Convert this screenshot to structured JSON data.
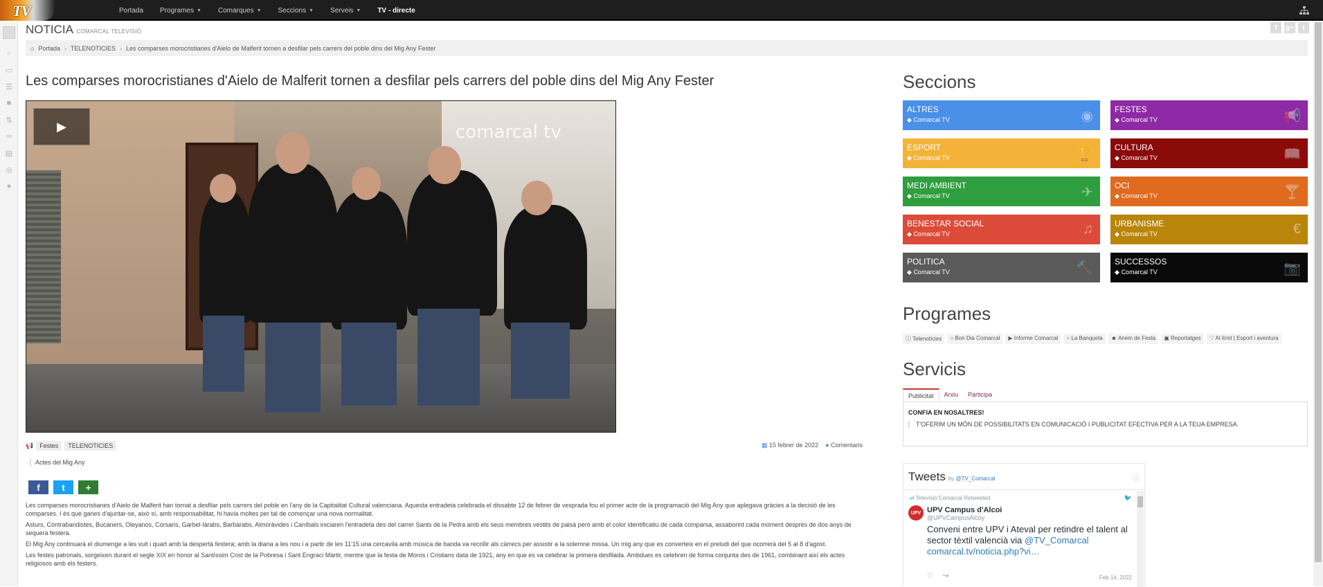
{
  "nav": {
    "logo_text": "TV",
    "items": [
      {
        "label": "Portada",
        "caret": false
      },
      {
        "label": "Programes",
        "caret": true
      },
      {
        "label": "Comarques",
        "caret": true
      },
      {
        "label": "Seccions",
        "caret": true
      },
      {
        "label": "Serveis",
        "caret": true
      },
      {
        "label": "TV - directe",
        "caret": false,
        "bold": true
      }
    ]
  },
  "header": {
    "title": "NOTICIA",
    "subtitle": "COMARCAL TELEVISIÓ"
  },
  "breadcrumb": {
    "home": "Portada",
    "section": "TELENOTICIES",
    "current": "Les comparses morocristianes d'Aielo de Malferit tornen a desfilar pels carrers del poble dins del Mig Any Fester"
  },
  "article": {
    "headline": "Les comparses morocristianes d'Aielo de Malferit tornen a desfilar pels carrers del poble dins del Mig Any Fester",
    "video_watermark": "comarcal tv",
    "tags": [
      "Festes",
      "TELENOTICIES"
    ],
    "date": "15 febrer de 2022",
    "comments": "Comentaris",
    "event": "Actes del Mig Any",
    "paragraphs": [
      "Les comparses morocristianes d'Aielo de Malferit han tornat a desfilar pels carrers del poble en l'any de la Capitalitat Cultural valenciana. Aquesta entradeta celebrada el dissabte 12 de febrer de vesprada fou el primer acte de la programació del Mig Any que aplegava gràcies a la decisió de les comparses. I és que ganes d'ajuntar-se, això sí, amb responsabilitat, hi havia moltes per tal de començar una nova normalitat.",
      "Asturs, Contrabandistes, Bucaners, Oleyanos, Corsaris, Garbel·làrabs, Barbàrabs, Almoràvides i Caníbals iniciaren l'entradeta des del carrer Sants de la Pedra amb els seus membres vestits de paisà però amb el color identificatiu de cada comparsa, assaborint cada moment després de dos anys de sequera festera.",
      "El Mig Any continuarà el diumenge a les vuit i quart amb la despertà festera; amb la diana a les nou i a partir de les 11'15 una cercavila amb música de banda va recollir als càrrecs per assistir a la solemne missa. Un mig any que es converteix en el preludi del que ocorrerà del 5 al 8 d'agost.",
      "Les festes patronals, sorgeixen durant el segle XIX en honor al Santíssim Crist de la Pobresa i Sant Engraci Màrtir, mentre que la festa de Moros i Cristians data de 1921, any en que es va celebrar la primera desfilada. Ambdues es celebren de forma conjunta des de 1961, combinant així els actes religiosos amb els festers."
    ]
  },
  "sidebar": {
    "seccions_title": "Seccions",
    "seccions": [
      {
        "title": "ALTRES",
        "sub": "Comarcal TV",
        "color": "#4a8fe8",
        "icon": "globe-icon",
        "glyph": "◉"
      },
      {
        "title": "FESTES",
        "sub": "Comarcal TV",
        "color": "#8e2aa5",
        "icon": "megaphone-icon",
        "glyph": "📢"
      },
      {
        "title": "ESPORT",
        "sub": "Comarcal TV",
        "color": "#f4b338",
        "icon": "trophy-icon",
        "glyph": "🏆"
      },
      {
        "title": "CULTURA",
        "sub": "Comarcal TV",
        "color": "#8b0a0a",
        "icon": "book-icon",
        "glyph": "📖"
      },
      {
        "title": "MEDI AMBIENT",
        "sub": "Comarcal TV",
        "color": "#2e9e3e",
        "icon": "plane-icon",
        "glyph": "✈"
      },
      {
        "title": "OCI",
        "sub": "Comarcal TV",
        "color": "#e06a1e",
        "icon": "cocktail-icon",
        "glyph": "🍸"
      },
      {
        "title": "BENESTAR SOCIAL",
        "sub": "Comarcal TV",
        "color": "#dc4b3a",
        "icon": "music-icon",
        "glyph": "♫"
      },
      {
        "title": "URBANISME",
        "sub": "Comarcal TV",
        "color": "#b9860b",
        "icon": "euro-icon",
        "glyph": "€"
      },
      {
        "title": "POLITICA",
        "sub": "Comarcal TV",
        "color": "#5a5a5a",
        "icon": "gavel-icon",
        "glyph": "🔨"
      },
      {
        "title": "SUCCESSOS",
        "sub": "Comarcal TV",
        "color": "#0a0a0a",
        "icon": "camera-icon",
        "glyph": "📷"
      }
    ],
    "programes_title": "Programes",
    "programes": [
      "Telenotícies",
      "Bon Dia Comarcal",
      "Informe Comarcal",
      "La Banqueta",
      "Anem de Festa",
      "Reportatges",
      "Al límit | Esport i aventura"
    ],
    "servicis_title": "Servicis",
    "tabs": [
      "Publicitat",
      "Arxiu",
      "Participa"
    ],
    "servicis_head": "CONFIA EN NOSALTRES!",
    "servicis_text": "T'OFERIM UN MÓN DE POSSIBILITATS EN COMUNICACIÓ I PUBLICITAT EFECTIVA PER A LA TEUA EMPRESA."
  },
  "twitter": {
    "title": "Tweets",
    "by": "by",
    "account": "@TV_Comarcal",
    "retweet_note": "Televisió Comarcal Retweeted",
    "avatar_text": "UPV",
    "author_name": "UPV Campus d'Alcoi",
    "author_handle": "@UPVCampusAlcoy",
    "text_plain": "Conveni entre UPV i Ateval per retindre el talent al sector tèxtil valencià via ",
    "text_mention": "@TV_Comarcal",
    "text_link": "comarcal.tv/noticia.php?vi…",
    "date": "Feb 14, 2022"
  }
}
